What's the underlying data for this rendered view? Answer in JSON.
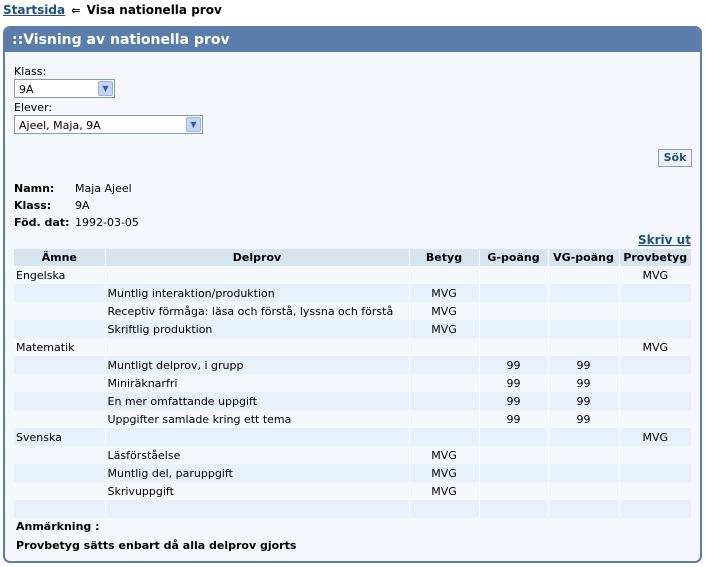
{
  "breadcrumb": {
    "home": "Startsida",
    "arrow": "⇐",
    "current": "Visa nationella prov"
  },
  "panel": {
    "title": "::Visning av nationella prov"
  },
  "filters": {
    "class_label": "Klass:",
    "class_value": "9A",
    "students_label": "Elever:",
    "student_value": "Ajeel, Maja, 9A",
    "search_button": "Sök"
  },
  "student": {
    "name_label": "Namn:",
    "name": "Maja Ajeel",
    "class_label": "Klass:",
    "class": "9A",
    "dob_label": "Föd. dat:",
    "dob": "1992-03-05"
  },
  "print_link": "Skriv ut",
  "table": {
    "columns": [
      "Ämne",
      "Delprov",
      "Betyg",
      "G-poäng",
      "VG-poäng",
      "Provbetyg"
    ],
    "rows": [
      [
        "Engelska",
        "",
        "",
        "",
        "",
        "MVG"
      ],
      [
        "",
        "Muntlig interaktion/produktion",
        "MVG",
        "",
        "",
        ""
      ],
      [
        "",
        "Receptiv förmåga: läsa och förstå, lyssna och förstå",
        "MVG",
        "",
        "",
        ""
      ],
      [
        "",
        "Skriftlig produktion",
        "MVG",
        "",
        "",
        ""
      ],
      [
        "Matematik",
        "",
        "",
        "",
        "",
        "MVG"
      ],
      [
        "",
        "Muntligt delprov, i grupp",
        "",
        "99",
        "99",
        ""
      ],
      [
        "",
        "Miniräknarfri",
        "",
        "99",
        "99",
        ""
      ],
      [
        "",
        "En mer omfattande uppgift",
        "",
        "99",
        "99",
        ""
      ],
      [
        "",
        "Uppgifter samlade kring ett tema",
        "",
        "99",
        "99",
        ""
      ],
      [
        "Svenska",
        "",
        "",
        "",
        "",
        "MVG"
      ],
      [
        "",
        "Läsförståelse",
        "MVG",
        "",
        "",
        ""
      ],
      [
        "",
        "Muntlig del, paruppgift",
        "MVG",
        "",
        "",
        ""
      ],
      [
        "",
        "Skrivuppgift",
        "MVG",
        "",
        "",
        ""
      ],
      [
        "",
        "",
        "",
        "",
        "",
        ""
      ]
    ]
  },
  "remark": {
    "label": "Anmärkning :",
    "text": "Provbetyg sätts enbart då alla delprov gjorts"
  }
}
